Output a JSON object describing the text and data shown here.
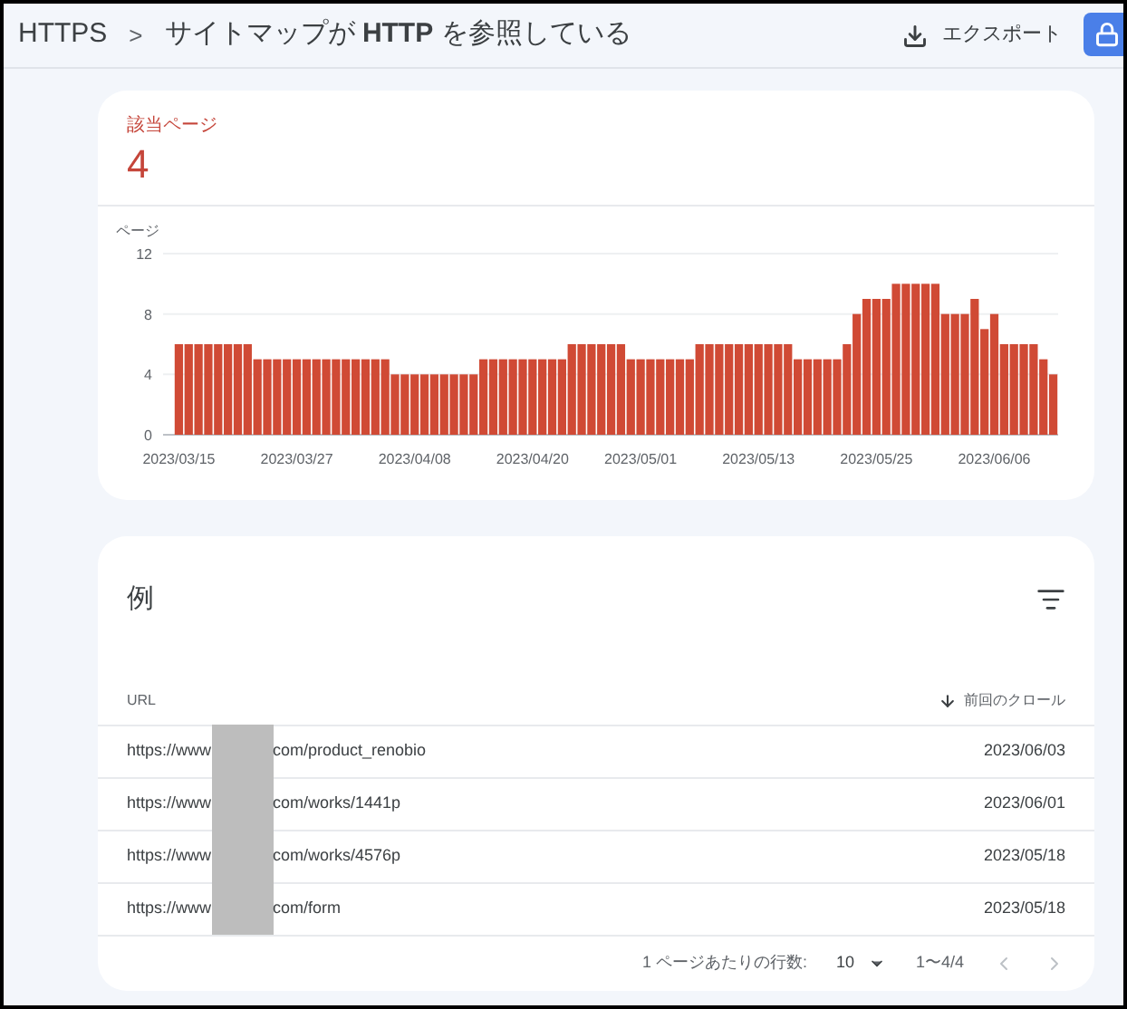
{
  "breadcrumb": {
    "parent": "HTTPS",
    "separator": ">",
    "current_prefix": "サイトマップが ",
    "current_bold": "HTTP",
    "current_suffix": " を参照している"
  },
  "export_button": {
    "label": "エクスポート"
  },
  "summary": {
    "label": "該当ページ",
    "value": "4"
  },
  "chart_data": {
    "type": "bar",
    "ylabel": "ページ",
    "ylim": [
      0,
      12
    ],
    "yticks": [
      0,
      4,
      8,
      12
    ],
    "color": "#d04a35",
    "values": [
      6,
      6,
      6,
      6,
      6,
      6,
      6,
      6,
      5,
      5,
      5,
      5,
      5,
      5,
      5,
      5,
      5,
      5,
      5,
      5,
      5,
      5,
      4,
      4,
      4,
      4,
      4,
      4,
      4,
      4,
      4,
      5,
      5,
      5,
      5,
      5,
      5,
      5,
      5,
      5,
      6,
      6,
      6,
      6,
      6,
      6,
      5,
      5,
      5,
      5,
      5,
      5,
      5,
      6,
      6,
      6,
      6,
      6,
      6,
      6,
      6,
      6,
      6,
      5,
      5,
      5,
      5,
      5,
      6,
      8,
      9,
      9,
      9,
      10,
      10,
      10,
      10,
      10,
      8,
      8,
      8,
      9,
      7,
      8,
      6,
      6,
      6,
      6,
      5,
      4
    ],
    "categories": [
      "2023/03/15",
      null,
      null,
      null,
      null,
      null,
      null,
      null,
      null,
      null,
      null,
      null,
      "2023/03/27",
      null,
      null,
      null,
      null,
      null,
      null,
      null,
      null,
      null,
      null,
      null,
      "2023/04/08",
      null,
      null,
      null,
      null,
      null,
      null,
      null,
      null,
      null,
      null,
      null,
      "2023/04/20",
      null,
      null,
      null,
      null,
      null,
      null,
      null,
      null,
      null,
      null,
      "2023/05/01",
      null,
      null,
      null,
      null,
      null,
      null,
      null,
      null,
      null,
      null,
      null,
      "2023/05/13",
      null,
      null,
      null,
      null,
      null,
      null,
      null,
      null,
      null,
      null,
      null,
      "2023/05/25",
      null,
      null,
      null,
      null,
      null,
      null,
      null,
      null,
      null,
      null,
      null,
      "2023/06/06",
      null,
      null,
      null,
      null,
      null,
      null
    ]
  },
  "examples": {
    "title": "例",
    "columns": [
      {
        "label": "URL",
        "sorted": false
      },
      {
        "label": "前回のクロール",
        "sorted": true
      }
    ],
    "rows": [
      {
        "url_start": "https://www",
        "url_end": "com/product_renobio",
        "date": "2023/06/03"
      },
      {
        "url_start": "https://www",
        "url_end": "com/works/1441p",
        "date": "2023/06/01"
      },
      {
        "url_start": "https://www",
        "url_end": "com/works/4576p",
        "date": "2023/05/18"
      },
      {
        "url_start": "https://www",
        "url_end": "com/form",
        "date": "2023/05/18"
      }
    ],
    "pagination": {
      "rows_label": "1 ページあたりの行数:",
      "rows_value": "10",
      "range": "1〜4/4"
    }
  }
}
